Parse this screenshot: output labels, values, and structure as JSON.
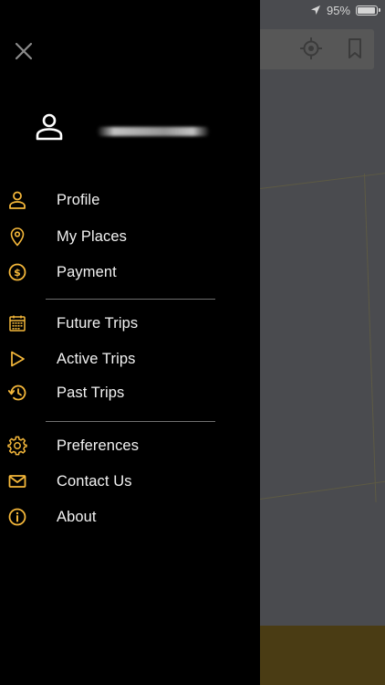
{
  "status_bar": {
    "battery": "95%",
    "battery_level": 0.95
  },
  "colors": {
    "accent": "#f4b73a",
    "drawer_bg": "#000000",
    "map_bg": "#4a4b4f"
  },
  "drawer": {
    "close_icon": "close-icon",
    "profile": {
      "avatar_icon": "person-icon",
      "name": ""
    },
    "sections": [
      [
        {
          "label": "Profile",
          "icon": "person-icon"
        },
        {
          "label": "My Places",
          "icon": "map-pin-icon"
        },
        {
          "label": "Payment",
          "icon": "dollar-coin-icon"
        }
      ],
      [
        {
          "label": "Future Trips",
          "icon": "calendar-icon"
        },
        {
          "label": "Active Trips",
          "icon": "play-icon"
        },
        {
          "label": "Past Trips",
          "icon": "history-icon"
        }
      ],
      [
        {
          "label": "Preferences",
          "icon": "gear-icon"
        },
        {
          "label": "Contact Us",
          "icon": "envelope-icon"
        },
        {
          "label": "About",
          "icon": "info-icon"
        }
      ]
    ]
  },
  "map": {
    "locate_icon": "crosshair-icon",
    "bookmark_icon": "bookmark-icon"
  }
}
